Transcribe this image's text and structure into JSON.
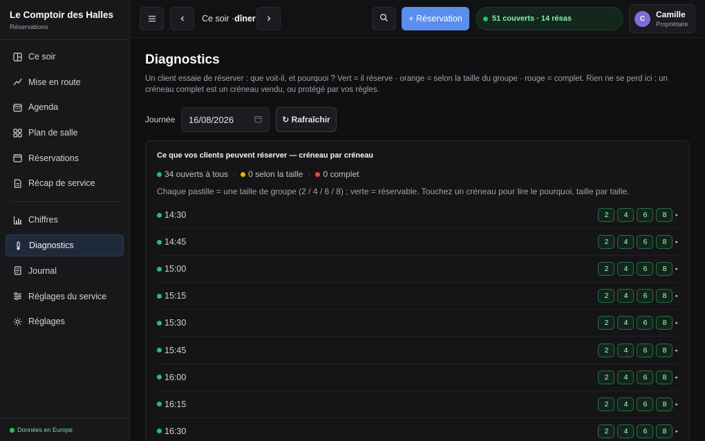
{
  "brand": {
    "title": "Le Comptoir des Halles",
    "subtitle": "Réservations"
  },
  "sidebar": {
    "items": [
      {
        "label": "Ce soir",
        "icon": "columns-icon"
      },
      {
        "label": "Mise en route",
        "icon": "trend-icon"
      },
      {
        "label": "Agenda",
        "icon": "calendar-icon"
      },
      {
        "label": "Plan de salle",
        "icon": "grid-icon"
      },
      {
        "label": "Réservations",
        "icon": "calendar-list-icon"
      },
      {
        "label": "Récap de service",
        "icon": "document-icon"
      },
      {
        "label": "Chiffres",
        "icon": "bar-chart-icon"
      },
      {
        "label": "Diagnostics",
        "icon": "thermometer-icon",
        "active": true
      },
      {
        "label": "Journal",
        "icon": "journal-icon"
      },
      {
        "label": "Réglages du service",
        "icon": "sliders-icon"
      },
      {
        "label": "Réglages",
        "icon": "sun-gear-icon"
      }
    ],
    "footer": "Données en Europe"
  },
  "header": {
    "service_prefix": "Ce soir ·",
    "service_name": "dîner",
    "reservation_button": "+ Réservation",
    "status": "51 couverts · 14 résas",
    "user": {
      "initial": "C",
      "name": "Camille",
      "role": "Propriétaire"
    }
  },
  "main": {
    "title": "Diagnostics",
    "description": "Un client essaie de réserver : que voit-il, et pourquoi ? Vert = il réserve · orange = selon la taille du groupe · rouge = complet. Rien ne se perd ici : un créneau complet est un créneau vendu, ou protégé par vos règles.",
    "day_label": "Journée",
    "date_value": "16/08/2026",
    "refresh_label": "↻ Rafraîchir",
    "panel": {
      "title": "Ce que vos clients peuvent réserver — créneau par créneau",
      "legend": {
        "open": "34 ouverts à tous",
        "partial": "0 selon la taille",
        "full": "0 complet",
        "separator": "·"
      },
      "note": "Chaque pastille = une taille de groupe (2 / 4 / 6 / 8) ; verte = réservable. Touchez un créneau pour lire le pourquoi, taille par taille.",
      "party_sizes": [
        "2",
        "4",
        "6",
        "8"
      ],
      "slots": [
        {
          "time": "14:30",
          "status": "green"
        },
        {
          "time": "14:45",
          "status": "green"
        },
        {
          "time": "15:00",
          "status": "green"
        },
        {
          "time": "15:15",
          "status": "green"
        },
        {
          "time": "15:30",
          "status": "green"
        },
        {
          "time": "15:45",
          "status": "green"
        },
        {
          "time": "16:00",
          "status": "green"
        },
        {
          "time": "16:15",
          "status": "green"
        },
        {
          "time": "16:30",
          "status": "green"
        }
      ]
    }
  },
  "colors": {
    "accent": "#5b8def",
    "available": "#22c55e",
    "partial": "#eab308",
    "full": "#ef4444"
  }
}
